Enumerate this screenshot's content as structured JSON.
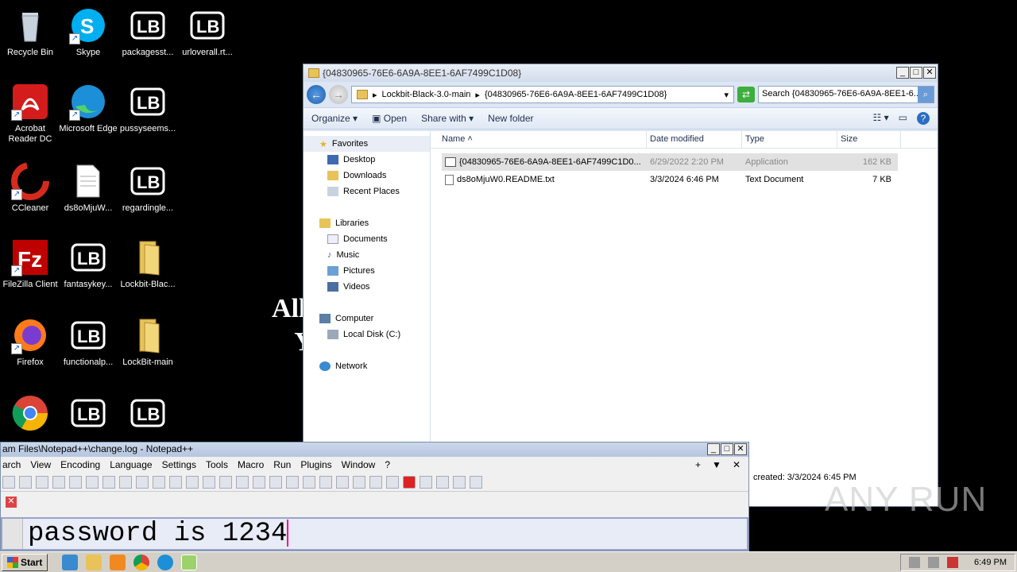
{
  "desktop": {
    "icons": [
      {
        "label": "Recycle Bin",
        "icon": "recycle-bin-icon"
      },
      {
        "label": "Skype",
        "icon": "skype-icon"
      },
      {
        "label": "packagesst...",
        "icon": "lockbit-file-icon"
      },
      {
        "label": "urloverall.rt...",
        "icon": "lockbit-file-icon"
      },
      {
        "label": "Acrobat Reader DC",
        "icon": "acrobat-icon"
      },
      {
        "label": "Microsoft Edge",
        "icon": "edge-icon"
      },
      {
        "label": "pussyseems...",
        "icon": "lockbit-file-icon"
      },
      {
        "label": "CCleaner",
        "icon": "ccleaner-icon"
      },
      {
        "label": "ds8oMjuW...",
        "icon": "text-file-icon"
      },
      {
        "label": "regardingle...",
        "icon": "lockbit-file-icon"
      },
      {
        "label": "FileZilla Client",
        "icon": "filezilla-icon"
      },
      {
        "label": "fantasykey...",
        "icon": "lockbit-file-icon"
      },
      {
        "label": "Lockbit-Blac...",
        "icon": "folder-icon"
      },
      {
        "label": "Firefox",
        "icon": "firefox-icon"
      },
      {
        "label": "functionalp...",
        "icon": "lockbit-file-icon"
      },
      {
        "label": "LockBit-main",
        "icon": "folder-icon"
      },
      {
        "label": "",
        "icon": "chrome-icon"
      },
      {
        "label": "",
        "icon": "lockbit-file-icon"
      },
      {
        "label": "",
        "icon": "lockbit-file-icon"
      }
    ],
    "ransom_line1": "All your",
    "ransom_line2": "You m"
  },
  "explorer": {
    "title": "{04830965-76E6-6A9A-8EE1-6AF7499C1D08}",
    "address_parent": "Lockbit-Black-3.0-main",
    "address_current": "{04830965-76E6-6A9A-8EE1-6AF7499C1D08}",
    "search_placeholder": "Search {04830965-76E6-6A9A-8EE1-6...",
    "toolbar": {
      "organize": "Organize",
      "open": "Open",
      "share_with": "Share with",
      "new_folder": "New folder"
    },
    "nav": {
      "favorites": "Favorites",
      "desktop": "Desktop",
      "downloads": "Downloads",
      "recent": "Recent Places",
      "libraries": "Libraries",
      "documents": "Documents",
      "music": "Music",
      "pictures": "Pictures",
      "videos": "Videos",
      "computer": "Computer",
      "local_disk": "Local Disk (C:)",
      "network": "Network"
    },
    "columns": {
      "name": "Name",
      "date": "Date modified",
      "type": "Type",
      "size": "Size"
    },
    "files": [
      {
        "name": "{04830965-76E6-6A9A-8EE1-6AF7499C1D0...",
        "date": "6/29/2022 2:20 PM",
        "type": "Application",
        "size": "162 KB"
      },
      {
        "name": "ds8oMjuW0.README.txt",
        "date": "3/3/2024 6:46 PM",
        "type": "Text Document",
        "size": "7 KB"
      }
    ],
    "status": "created: 3/3/2024 6:45 PM"
  },
  "notepad": {
    "title": "am Files\\Notepad++\\change.log - Notepad++",
    "menu": [
      "arch",
      "View",
      "Encoding",
      "Language",
      "Settings",
      "Tools",
      "Macro",
      "Run",
      "Plugins",
      "Window",
      "?"
    ],
    "menu_right_plus": "+",
    "menu_right_arrow": "▼",
    "menu_right_close": "✕",
    "editor_text": "password is 1234"
  },
  "taskbar": {
    "start": "Start",
    "clock": "6:49 PM"
  },
  "watermark": "ANY RUN"
}
